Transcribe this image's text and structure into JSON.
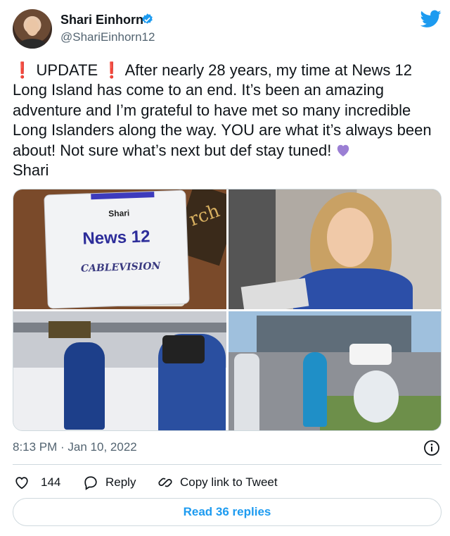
{
  "author": {
    "name": "Shari Einhorn",
    "handle": "@ShariEinhorn12",
    "verified": true
  },
  "tweet": {
    "update_label": "UPDATE",
    "text_body": "After nearly 28 years, my time at News 12 Long Island has come to an end. It’s been an amazing adventure and I’m grateful to have met so many incredible Long Islanders along the way. YOU are what it’s always been about! Not sure what’s next but def stay tuned!",
    "signature": "Shari"
  },
  "media": {
    "badge_name": "Shari",
    "badge_title": "News 12",
    "badge_company": "CABLEVISION",
    "lanyard_text": "rch"
  },
  "meta": {
    "timestamp": "8:13 PM · Jan 10, 2022"
  },
  "actions": {
    "like_count": "144",
    "reply_label": "Reply",
    "copy_label": "Copy link to Tweet"
  },
  "footer": {
    "read_replies_label": "Read 36 replies"
  },
  "colors": {
    "accent": "#1d9bf0",
    "text": "#0f1419",
    "secondary": "#536471",
    "alert": "#e0245e",
    "purple_heart": "#9b7fd4"
  },
  "icons": [
    "verified-badge-icon",
    "twitter-bird-icon",
    "info-icon",
    "heart-icon",
    "reply-icon",
    "link-icon",
    "exclamation-icon",
    "purple-heart-icon"
  ]
}
